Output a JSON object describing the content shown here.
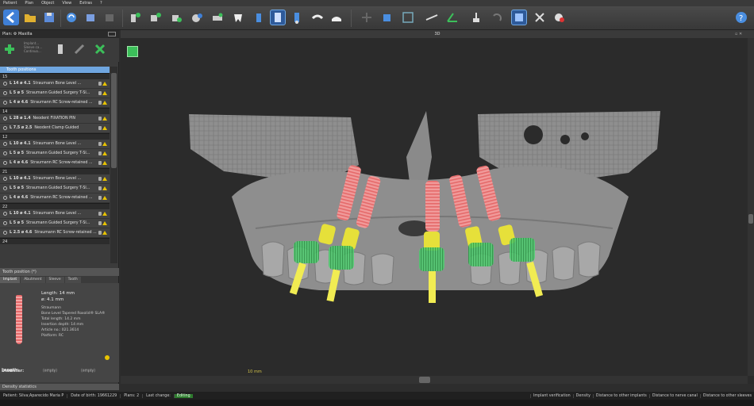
{
  "menu": [
    "Patient",
    "Plan",
    "Object",
    "View",
    "Extras",
    "?"
  ],
  "colors": {
    "accent": "#6fa6e0",
    "editing": "#2e7a2e",
    "implant_red": "#e56a6a",
    "implant_yellow": "#e6e03a",
    "sleeve_green": "#3cc05a",
    "warning": "#e8c300"
  },
  "toolbar_icons": [
    "back-arrow-icon",
    "open-folder-icon",
    "save-icon",
    "refresh-icon",
    "box-icon",
    "add-implant-icon",
    "add-sleeve-icon",
    "add-anchor-icon",
    "add-abutment-icon",
    "teeth-icon",
    "select-icon",
    "implant-icon",
    "selected-implant-icon",
    "implant-blue-icon",
    "guide-icon",
    "scan-guide-icon",
    "plus-icon",
    "cube-icon",
    "frame-icon",
    "measure-icon",
    "angle-icon",
    "stamp-icon",
    "undo-icon",
    "view-cube-icon",
    "tools-icon",
    "settings-icon",
    "help-icon"
  ],
  "left": {
    "plan_title": "Plan: ⚙ Maxilla",
    "action_lines": [
      "Implant...",
      "Sleeve ca...",
      "Continuo..."
    ],
    "tree_header": "Tooth positions",
    "groups": [
      {
        "name": "15",
        "items": [
          {
            "dims": "L 14 ø 4.1",
            "desc": "Straumann Bone Level ..."
          },
          {
            "dims": "L 5 ø 5",
            "desc": "Straumann Guided Surgery T-Sl..."
          },
          {
            "dims": "L 4 ø 4.6",
            "desc": "Straumann RC Screw-retained ..."
          }
        ]
      },
      {
        "name": "14",
        "items": [
          {
            "dims": "L 28 ø 1.4",
            "desc": "Neodent FIXATION PIN"
          },
          {
            "dims": "L 7.5 ø 2.5",
            "desc": "Neodent Clamp Guided"
          }
        ]
      },
      {
        "name": "12",
        "items": [
          {
            "dims": "L 10 ø 4.1",
            "desc": "Straumann Bone Level ..."
          },
          {
            "dims": "L 5 ø 5",
            "desc": "Straumann Guided Surgery T-Sl..."
          },
          {
            "dims": "L 4 ø 4.6",
            "desc": "Straumann RC Screw-retained ..."
          }
        ]
      },
      {
        "name": "21",
        "items": [
          {
            "dims": "L 10 ø 4.1",
            "desc": "Straumann Bone Level ..."
          },
          {
            "dims": "L 5 ø 5",
            "desc": "Straumann Guided Surgery T-Sl..."
          },
          {
            "dims": "L 4 ø 4.6",
            "desc": "Straumann RC Screw-retained ..."
          }
        ]
      },
      {
        "name": "22",
        "items": [
          {
            "dims": "L 10 ø 4.1",
            "desc": "Straumann Bone Level ..."
          },
          {
            "dims": "L 5 ø 5",
            "desc": "Straumann Guided Surgery T-Sl..."
          },
          {
            "dims": "L 2.5 ø 4.6",
            "desc": "Straumann RC Screw-retained ..."
          }
        ]
      },
      {
        "name": "24",
        "items": []
      }
    ],
    "tooth_position_header": "Tooth position (*)",
    "tabs": [
      "Implant",
      "Abutment",
      "Sleeve",
      "Tooth"
    ],
    "implant": {
      "length": "Length: 14 mm",
      "diameter": "ø: 4.1 mm",
      "details": [
        "Straumann",
        "Bone Level Tapered Roxolid® SLA®",
        "Total length: 14.2 mm",
        "Insertion depth: 14 mm",
        "Article no.: 021.3614",
        "Platform: RC"
      ]
    },
    "diameter_label": "Diameter:",
    "length_label": "Length:",
    "empty": "(empty)",
    "density_header": "Density statistics"
  },
  "view": {
    "title": "3D",
    "scale_label": "10 mm"
  },
  "status": {
    "patient": "Patient: Silva;Aparecido Maria P",
    "dob": "Date of birth: 19661229",
    "plans": "Plans: 2",
    "last_change": "Last change:",
    "editing": "Editing",
    "right": [
      "Implant verification",
      "Density",
      "Distance to other implants",
      "Distance to nerve canal",
      "Distance to other sleeves"
    ]
  }
}
